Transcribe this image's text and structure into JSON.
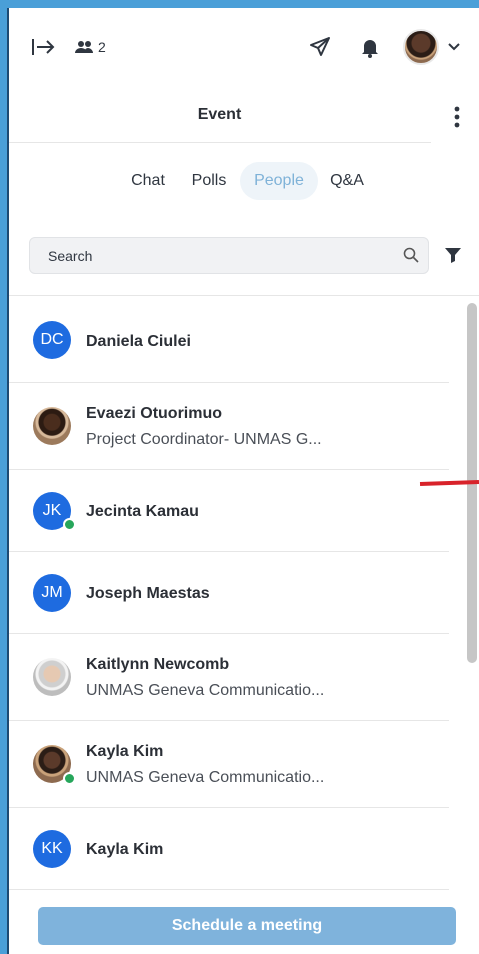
{
  "header": {
    "participant_count": "2",
    "icons": [
      "exit-icon",
      "people-icon",
      "send-icon",
      "bell-icon",
      "avatar",
      "chevron-down-icon"
    ]
  },
  "title_bar": {
    "title": "Event"
  },
  "tabs": [
    {
      "label": "Chat"
    },
    {
      "label": "Polls"
    },
    {
      "label": "People",
      "active": true
    },
    {
      "label": "Q&A"
    }
  ],
  "search": {
    "placeholder": "Search"
  },
  "people": [
    {
      "initials": "DC",
      "name": "Daniela Ciulei",
      "subtitle": ""
    },
    {
      "initials": "",
      "name": "Evaezi Otuorimuo",
      "subtitle": "Project Coordinator- UNMAS G..."
    },
    {
      "initials": "JK",
      "name": "Jecinta Kamau",
      "subtitle": "",
      "online": true
    },
    {
      "initials": "JM",
      "name": "Joseph Maestas",
      "subtitle": ""
    },
    {
      "initials": "",
      "name": "Kaitlynn Newcomb",
      "subtitle": "UNMAS Geneva Communicatio..."
    },
    {
      "initials": "",
      "name": "Kayla Kim",
      "subtitle": "UNMAS Geneva Communicatio...",
      "online": true
    },
    {
      "initials": "KK",
      "name": "Kayla Kim",
      "subtitle": ""
    }
  ],
  "footer": {
    "schedule_label": "Schedule a meeting"
  },
  "colors": {
    "accent": "#7fb3dc",
    "avatar_blue": "#1e6be0",
    "online_green": "#26a65b",
    "frame_blue": "#4a9fd8"
  }
}
